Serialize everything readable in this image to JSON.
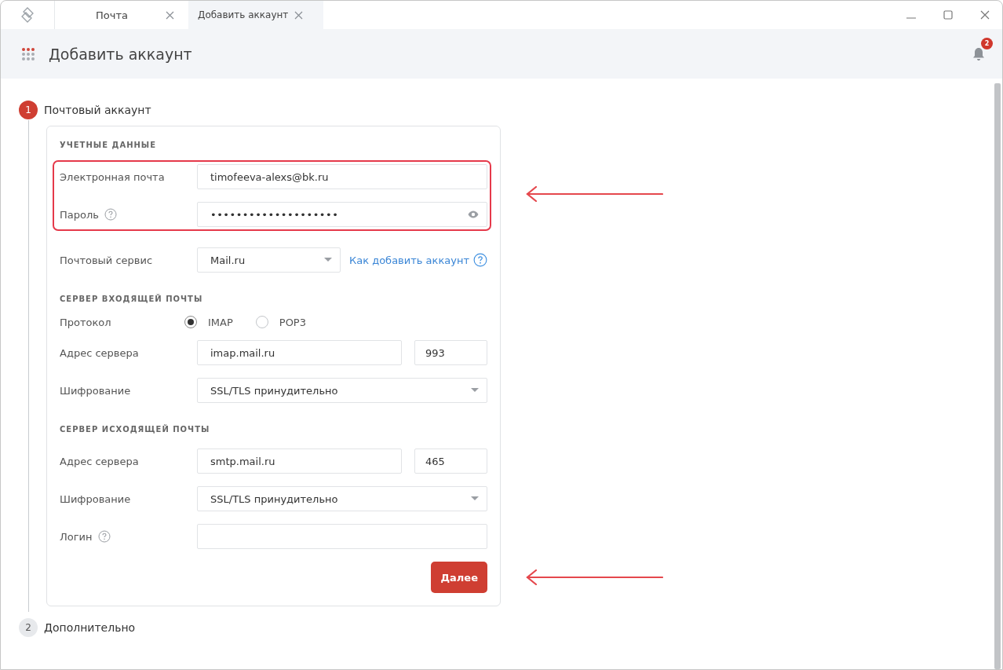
{
  "tabs": [
    {
      "label": "Почта",
      "selected": false
    },
    {
      "label": "Добавить аккаунт",
      "selected": true
    }
  ],
  "header": {
    "title": "Добавить аккаунт",
    "notifications": "2"
  },
  "steps": [
    {
      "number": "1",
      "title": "Почтовый аккаунт",
      "active": true,
      "sections": [
        {
          "heading": "УЧЕТНЫЕ ДАННЫЕ",
          "highlighted": true,
          "rows": [
            {
              "kind": "input",
              "label": "Электронная почта",
              "value": "timofeeva-alexs@bk.ru"
            },
            {
              "kind": "password",
              "label": "Пароль",
              "help": true,
              "value": "••••••••••••••••••••"
            }
          ]
        },
        {
          "rows": [
            {
              "kind": "select",
              "label": "Почтовый сервис",
              "value": "Mail.ru",
              "link": "Как добавить аккаунт"
            }
          ]
        },
        {
          "heading": "СЕРВЕР ВХОДЯЩЕЙ ПОЧТЫ",
          "rows": [
            {
              "kind": "radio",
              "label": "Протокол",
              "options": [
                {
                  "label": "IMAP",
                  "selected": true
                },
                {
                  "label": "POP3",
                  "selected": false
                }
              ]
            },
            {
              "kind": "address",
              "label": "Адрес сервера",
              "value": "imap.mail.ru",
              "port": "993"
            },
            {
              "kind": "wide-select",
              "label": "Шифрование",
              "value": "SSL/TLS принудительно"
            }
          ]
        },
        {
          "heading": "СЕРВЕР ИСХОДЯЩЕЙ ПОЧТЫ",
          "rows": [
            {
              "kind": "address",
              "label": "Адрес сервера",
              "value": "smtp.mail.ru",
              "port": "465"
            },
            {
              "kind": "wide-select",
              "label": "Шифрование",
              "value": "SSL/TLS принудительно"
            },
            {
              "kind": "input",
              "label": "Логин",
              "help": true
            }
          ]
        }
      ],
      "button": "Далее"
    },
    {
      "number": "2",
      "title": "Дополнительно",
      "active": false
    }
  ]
}
